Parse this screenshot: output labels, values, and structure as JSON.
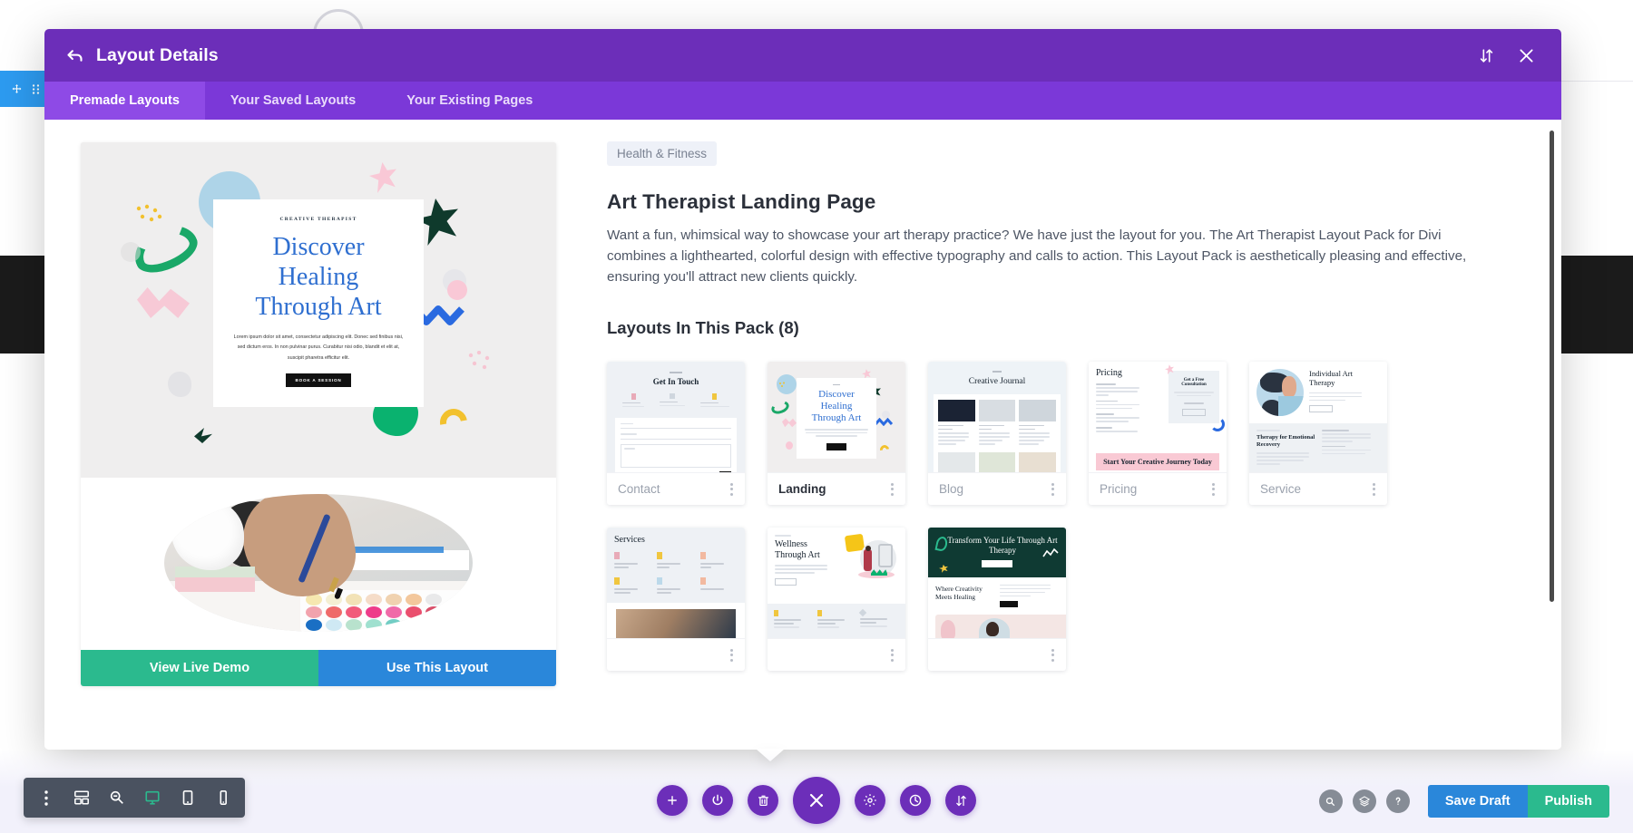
{
  "modal": {
    "header": {
      "title": "Layout Details",
      "back_icon": "back-arrow-icon",
      "sort_icon": "sort-updown-icon",
      "close_icon": "close-x-icon"
    },
    "tabs": [
      {
        "label": "Premade Layouts",
        "active": true
      },
      {
        "label": "Your Saved Layouts",
        "active": false
      },
      {
        "label": "Your Existing Pages",
        "active": false
      }
    ]
  },
  "preview": {
    "hero": {
      "eyebrow": "CREATIVE THERAPIST",
      "title_line1": "Discover",
      "title_line2": "Healing",
      "title_line3": "Through Art",
      "paragraph": "Lorem ipsum dolor sit amet, consectetur adipiscing elit. Donec sed finibus nisi, sed dictum eros. In non pulvinar purus. Curabitur nisi odio, blandit et elit at, suscipit pharetra efficitur elit.",
      "cta": "BOOK A SESSION",
      "title_color": "#2f6fd0"
    },
    "actions": {
      "view_demo": "View Live Demo",
      "use_layout": "Use This Layout",
      "demo_color": "#2bba8e",
      "use_color": "#2a87da"
    }
  },
  "detail": {
    "category_badge": "Health & Fitness",
    "title": "Art Therapist Landing Page",
    "description": "Want a fun, whimsical way to showcase your art therapy practice? We have just the layout for you. The Art Therapist Layout Pack for Divi combines a lighthearted, colorful design with effective typography and calls to action. This Layout Pack is aesthetically pleasing and effective, ensuring you'll attract new clients quickly.",
    "pack_heading": "Layouts In This Pack (8)",
    "layouts": [
      {
        "name": "Contact",
        "active": false,
        "thumb_heading": "Get In Touch"
      },
      {
        "name": "Landing",
        "active": true,
        "thumb_heading": "Discover Healing Through Art"
      },
      {
        "name": "Blog",
        "active": false,
        "thumb_heading": "Creative Journal"
      },
      {
        "name": "Pricing",
        "active": false,
        "thumb_heading": "Pricing"
      },
      {
        "name": "Service",
        "active": false,
        "thumb_heading": "Individual Art Therapy"
      },
      {
        "name": "",
        "active": false,
        "thumb_heading": "Services"
      },
      {
        "name": "",
        "active": false,
        "thumb_heading": "Wellness Through Art"
      },
      {
        "name": "",
        "active": false,
        "thumb_heading": "Transform Your Life Through Art Therapy"
      }
    ],
    "thumb_text": {
      "pricing_banner": "Start Your Creative Journey Today",
      "pricing_box": "Get a Free Consultation",
      "service_sub": "Therapy for Emotional Recovery",
      "dark_sub": "Where Creativity Meets Healing",
      "contact_fields": [
        "Name",
        "Email",
        "Message"
      ]
    },
    "menu_icon": "vertical-dots-icon"
  },
  "bottom_bar": {
    "left_tools": [
      {
        "icon": "vertical-dots-icon",
        "active": false
      },
      {
        "icon": "wireframe-icon",
        "active": false
      },
      {
        "icon": "zoom-out-icon",
        "active": false
      },
      {
        "icon": "desktop-icon",
        "active": true
      },
      {
        "icon": "tablet-icon",
        "active": false
      },
      {
        "icon": "phone-icon",
        "active": false
      }
    ],
    "center_tools": [
      {
        "icon": "plus-icon",
        "big": false
      },
      {
        "icon": "power-icon",
        "big": false
      },
      {
        "icon": "trash-icon",
        "big": false
      },
      {
        "icon": "close-x-icon",
        "big": true
      },
      {
        "icon": "gear-icon",
        "big": false
      },
      {
        "icon": "history-clock-icon",
        "big": false
      },
      {
        "icon": "sort-updown-icon",
        "big": false
      }
    ],
    "right_tools": [
      {
        "icon": "search-icon"
      },
      {
        "icon": "layers-icon"
      },
      {
        "icon": "help-question-icon"
      }
    ],
    "save_draft_label": "Save Draft",
    "publish_label": "Publish"
  },
  "colors": {
    "purple_header": "#6c2eb9",
    "purple_tabs": "#7b38d8",
    "purple_tab_active": "#8e4ae6",
    "blue": "#2a87da",
    "green": "#2bba8e",
    "toolbar_dark": "#4a5260"
  }
}
